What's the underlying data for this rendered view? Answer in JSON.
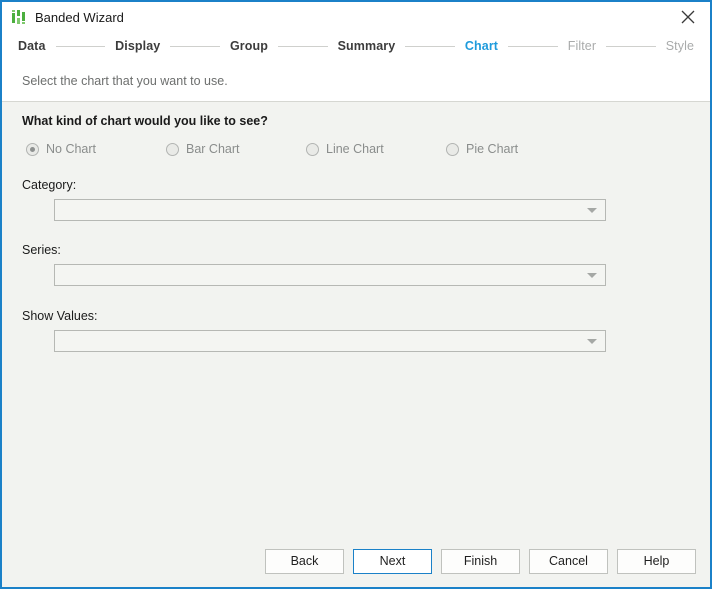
{
  "window": {
    "title": "Banded Wizard",
    "icon": "banded-report-icon",
    "close_icon": "close-icon",
    "border_color": "#1b81c8",
    "body_bg": "#f2f3f0"
  },
  "stepper": {
    "accent_color": "#1e9bdc",
    "steps": [
      {
        "label": "Data",
        "state": "done"
      },
      {
        "label": "Display",
        "state": "done"
      },
      {
        "label": "Group",
        "state": "done"
      },
      {
        "label": "Summary",
        "state": "done"
      },
      {
        "label": "Chart",
        "state": "active"
      },
      {
        "label": "Filter",
        "state": "todo"
      },
      {
        "label": "Style",
        "state": "todo"
      }
    ]
  },
  "description": "Select the chart that you want to use.",
  "main": {
    "question": "What kind of chart would you like to see?",
    "chart_options": [
      {
        "label": "No Chart",
        "selected": true
      },
      {
        "label": "Bar Chart",
        "selected": false
      },
      {
        "label": "Line Chart",
        "selected": false
      },
      {
        "label": "Pie Chart",
        "selected": false
      }
    ],
    "fields": [
      {
        "label": "Category:",
        "value": "",
        "arrow_icon": "chevron-down-icon"
      },
      {
        "label": "Series:",
        "value": "",
        "arrow_icon": "chevron-down-icon"
      },
      {
        "label": "Show Values:",
        "value": "",
        "arrow_icon": "chevron-down-icon"
      }
    ]
  },
  "footer": {
    "buttons": [
      {
        "label": "Back",
        "default": false
      },
      {
        "label": "Next",
        "default": true
      },
      {
        "label": "Finish",
        "default": false
      },
      {
        "label": "Cancel",
        "default": false
      },
      {
        "label": "Help",
        "default": false
      }
    ]
  }
}
